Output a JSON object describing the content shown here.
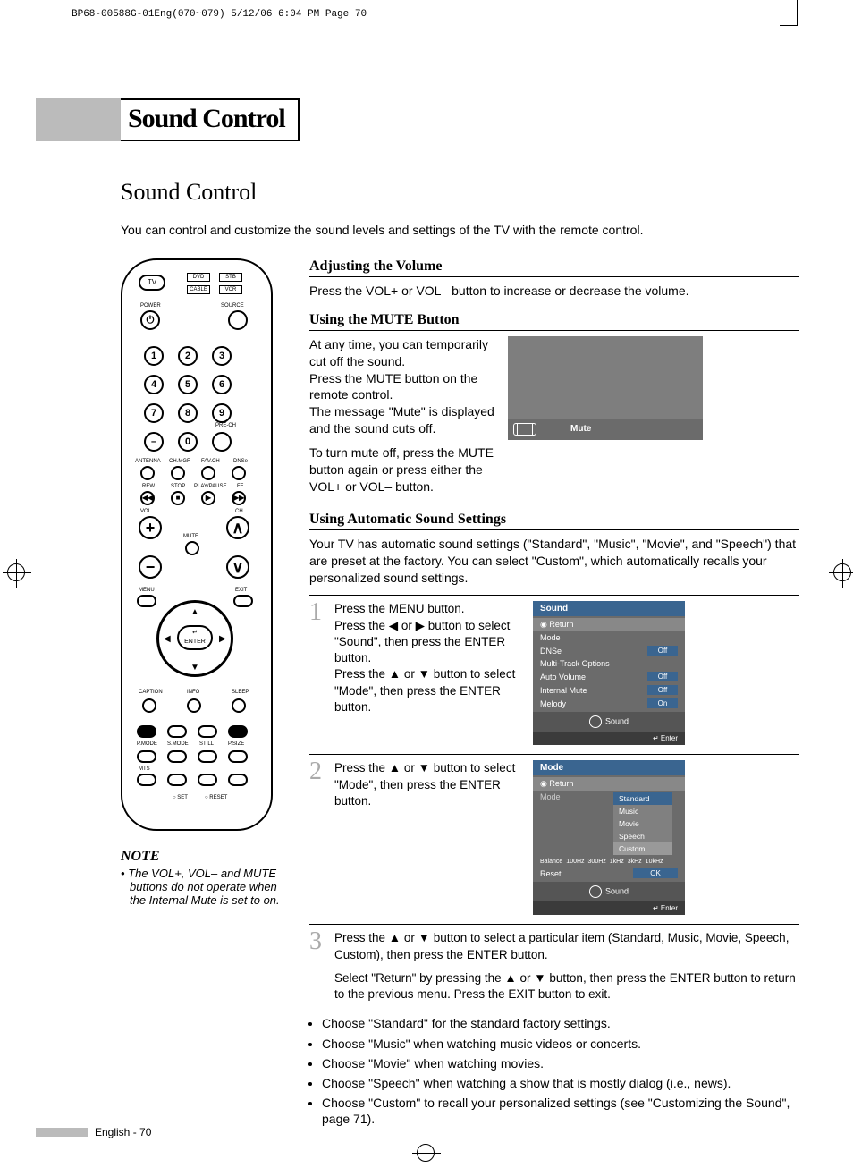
{
  "crop_header": "BP68-00588G-01Eng(070~079)  5/12/06  6:04 PM  Page 70",
  "title": "Sound Control",
  "section_title": "Sound Control",
  "intro": "You can control and customize the sound levels and settings of the TV with the remote control.",
  "subheads": {
    "adjust": "Adjusting the Volume",
    "mute": "Using the MUTE Button",
    "auto": "Using Automatic Sound Settings"
  },
  "adjust_text": "Press the VOL+ or VOL– button to increase or decrease the volume.",
  "mute_p1": "At any time, you can temporarily cut off the sound.\nPress the MUTE button on the remote control.\nThe message \"Mute\" is displayed and the sound cuts off.",
  "mute_p2": "To turn mute off, press the MUTE button again or press either the VOL+ or VOL– button.",
  "mute_osd_label": "Mute",
  "auto_intro": "Your TV has automatic sound settings (\"Standard\", \"Music\", \"Movie\", and \"Speech\") that are preset at the factory. You can select \"Custom\", which automatically recalls your personalized sound settings.",
  "steps": [
    "Press the MENU button.\nPress the ◀ or ▶ button to select \"Sound\", then press the ENTER button.\nPress the ▲ or ▼ button to select \"Mode\", then press the ENTER button.",
    "Press the ▲ or ▼ button to select \"Mode\", then press the ENTER button.",
    "Press the ▲ or ▼ button to select a particular item (Standard, Music, Movie, Speech, Custom), then press the ENTER button."
  ],
  "step3_extra": "Select \"Return\" by pressing the ▲ or ▼ button, then press the ENTER button to return to the previous menu. Press the EXIT button to exit.",
  "osd_sound": {
    "title": "Sound",
    "return": "Return",
    "rows": [
      {
        "label": "Mode",
        "val": ""
      },
      {
        "label": "DNSe",
        "val": "Off"
      },
      {
        "label": "Multi-Track Options",
        "val": ""
      },
      {
        "label": "Auto Volume",
        "val": "Off"
      },
      {
        "label": "Internal Mute",
        "val": "Off"
      },
      {
        "label": "Melody",
        "val": "On"
      }
    ],
    "foot": "Sound",
    "enter": "Enter"
  },
  "osd_mode": {
    "title": "Mode",
    "return": "Return",
    "mode_label": "Mode",
    "options": [
      "Standard",
      "Music",
      "Movie",
      "Speech",
      "Custom"
    ],
    "bands": [
      "Balance",
      "100Hz",
      "300Hz",
      "1kHz",
      "3kHz",
      "10kHz"
    ],
    "reset": "Reset",
    "ok": "OK",
    "foot": "Sound",
    "enter": "Enter"
  },
  "bullets": [
    "Choose \"Standard\" for the standard factory settings.",
    "Choose \"Music\" when watching music videos or concerts.",
    "Choose \"Movie\" when watching movies.",
    "Choose \"Speech\" when watching a show that is mostly dialog (i.e., news).",
    "Choose \"Custom\" to recall your personalized settings (see \"Customizing the Sound\", page 71)."
  ],
  "note": {
    "title": "NOTE",
    "text": "• The VOL+, VOL– and MUTE buttons do not operate when the Internal Mute is set to on."
  },
  "footer": "English - 70",
  "remote": {
    "tv": "TV",
    "dvd": "DVD",
    "stb": "STB",
    "cable": "CABLE",
    "vcr": "VCR",
    "power": "POWER",
    "source": "SOURCE",
    "numbers": [
      "1",
      "2",
      "3",
      "4",
      "5",
      "6",
      "7",
      "8",
      "9",
      "0"
    ],
    "prech": "PRE-CH",
    "antenna": "ANTENNA",
    "chmgr": "CH.MGR",
    "favch": "FAV.CH",
    "dnse": "DNSe",
    "rew": "REW",
    "stop": "STOP",
    "play": "PLAY/PAUSE",
    "ff": "FF",
    "vol": "VOL",
    "ch": "CH",
    "mute": "MUTE",
    "menu": "MENU",
    "exit": "EXIT",
    "enter": "ENTER",
    "caption": "CAPTION",
    "info": "INFO",
    "sleep": "SLEEP",
    "pmode": "P.MODE",
    "smode": "S.MODE",
    "still": "STILL",
    "psize": "P.SIZE",
    "mts": "MTS",
    "set": "SET",
    "reset": "RESET"
  }
}
